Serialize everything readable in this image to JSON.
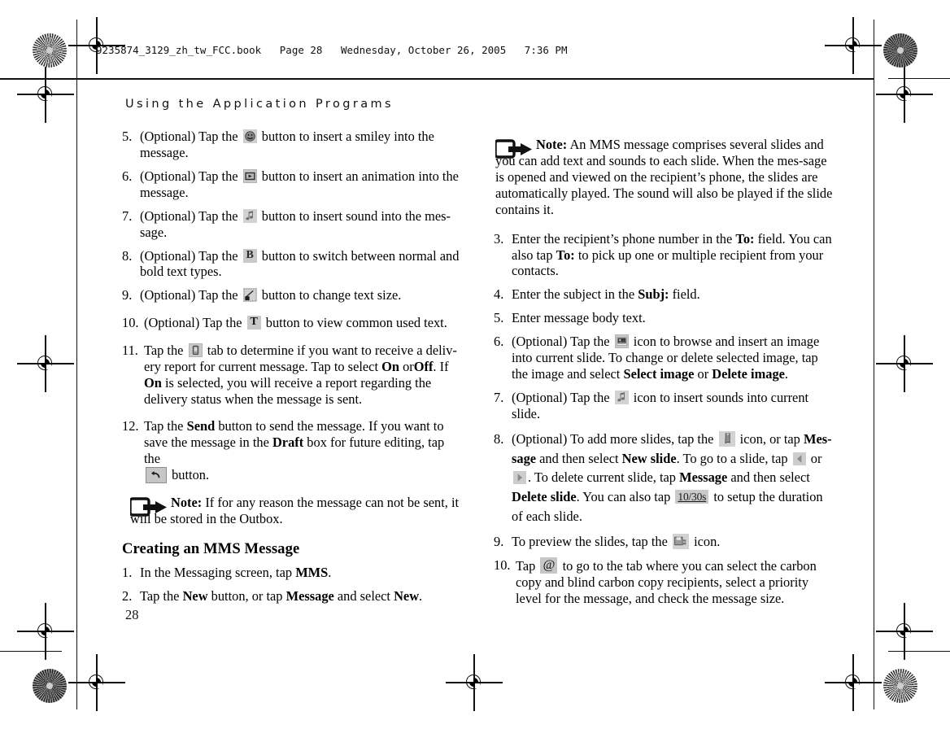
{
  "document": {
    "book_line": "9235874_3129_zh_tw_FCC.book   Page 28   Wednesday, October 26, 2005   7:36 PM",
    "chapter_title": "Using the Application Programs",
    "page_number": "28"
  },
  "left_column": {
    "steps": [
      {
        "num": "5.",
        "pre": "(Optional) Tap the",
        "icon": "smiley-icon",
        "post": "button to insert a smiley into the message."
      },
      {
        "num": "6.",
        "pre": "(Optional) Tap the",
        "icon": "animation-icon",
        "post": "button to insert an animation into the message."
      },
      {
        "num": "7.",
        "pre": "(Optional) Tap the",
        "icon": "sound-note-icon",
        "post": "button to insert sound into the mes-sage."
      },
      {
        "num": "8.",
        "pre": "(Optional) Tap the",
        "icon": "bold-b-icon",
        "post": "button to switch between normal and bold text types."
      },
      {
        "num": "9.",
        "pre": "(Optional) Tap the",
        "icon": "text-size-icon",
        "post": "button to change text size."
      },
      {
        "num": "10.",
        "pre": "(Optional) Tap the",
        "icon": "common-text-t-icon",
        "post": "button to view common used text."
      }
    ],
    "step11": {
      "num": "11.",
      "t1": "Tap the",
      "icon": "delivery-report-tab-icon",
      "t2": "tab to determine if you want to receive a deliv-ery report for current message. Tap to select",
      "b1": "On",
      "t3": "or",
      "b2": "Off",
      "t4": ". If",
      "b3": "On",
      "t5": "is selected, you will receive a report regarding the delivery status when the message is sent."
    },
    "step12": {
      "num": "12.",
      "t1": "Tap the",
      "b1": "Send",
      "t2": "button to send the message. If you want to save the message in the",
      "b2": "Draft",
      "t3": "box for future editing, tap the",
      "icon": "undo-arrow-button",
      "t4": "button."
    },
    "note": {
      "icon": "note-arrow-icon",
      "label": "Note:",
      "text": "If for any reason the message can not be sent, it will be stored in the Outbox."
    },
    "section_heading": "Creating an MMS Message",
    "mms_steps": [
      {
        "num": "1.",
        "t1": "In the Messaging screen, tap",
        "b1": "MMS",
        "t2": "."
      }
    ],
    "mms_step2": {
      "num": "2.",
      "t1": "Tap the",
      "b1": "New",
      "t2": "button, or tap",
      "b2": "Message",
      "t3": "and select",
      "b3": "New",
      "t4": "."
    }
  },
  "right_column": {
    "note": {
      "icon": "note-arrow-icon",
      "label": "Note:",
      "text": "An MMS message comprises several slides and you can add text and sounds to each slide. When the mes-sage is opened and viewed on the recipient’s phone, the slides are automatically played. The sound will also be played if the slide contains it."
    },
    "step3": {
      "num": "3.",
      "t1": "Enter the recipient’s phone number in the",
      "b1": "To:",
      "t2": "field. You can also tap",
      "b2": "To:",
      "t3": "to pick up one or multiple recipient from your contacts."
    },
    "step4": {
      "num": "4.",
      "t1": "Enter the subject in the",
      "b1": "Subj:",
      "t2": "field."
    },
    "step5": {
      "num": "5.",
      "t1": "Enter message body text."
    },
    "step6": {
      "num": "6.",
      "t1": "(Optional) Tap the",
      "icon": "insert-image-icon",
      "t2": "icon to browse and insert an image into current slide. To change or delete selected image, tap the image and select",
      "b1": "Select image",
      "t3": "or",
      "b2": "Delete image",
      "t4": "."
    },
    "step7": {
      "num": "7.",
      "t1": "(Optional) Tap the",
      "icon": "insert-sound-icon",
      "t2": "icon to insert sounds into current slide."
    },
    "step8": {
      "num": "8.",
      "t1": "(Optional) To add more slides, tap the",
      "icon": "new-slide-icon",
      "t2": "icon, or tap",
      "b1": "Mes-sage",
      "t3": "and then select",
      "b2": "New slide",
      "t4": ". To go to a slide, tap",
      "icon_prev": "previous-slide-arrow-icon",
      "t5": "or",
      "icon_next": "next-slide-arrow-icon",
      "t6": ". To delete current slide, tap",
      "b3": "Message",
      "t7": "and then select",
      "b4": "Delete slide",
      "t8": ". You can also tap",
      "duration_button": "10/30s",
      "t9": "to setup the duration of each slide."
    },
    "step9": {
      "num": "9.",
      "t1": "To preview the slides, tap the",
      "icon": "preview-slides-icon",
      "t2": "icon."
    },
    "step10": {
      "num": "10.",
      "t1": "Tap",
      "icon": "at-sign-button",
      "t2": "to go to the tab where you can select the carbon copy and blind carbon copy recipients, select a priority level for the message, and check the message size."
    }
  },
  "print_marks": {
    "registration_icon": "registration-target-icon",
    "star_icon": "star-resolution-target-icon"
  }
}
